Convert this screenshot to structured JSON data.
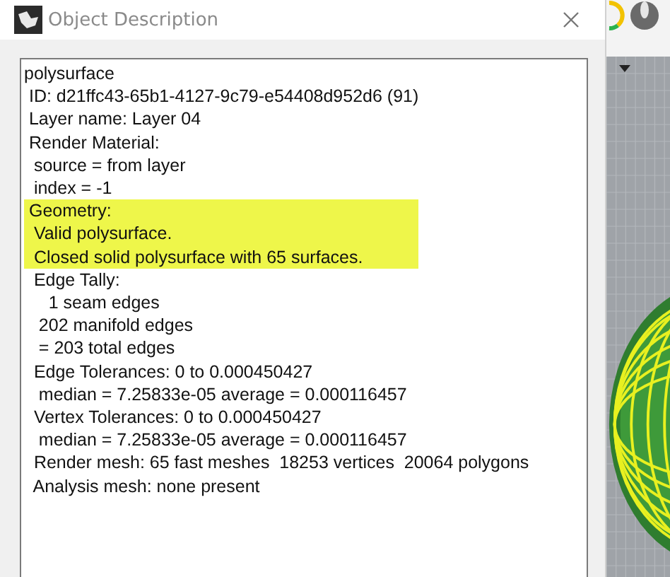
{
  "window": {
    "title": "Object Description"
  },
  "description_lines": [
    {
      "text": "polysurface",
      "highlighted": false
    },
    {
      "text": " ID: d21ffc43-65b1-4127-9c79-e54408d952d6 (91)",
      "highlighted": false
    },
    {
      "text": " Layer name: Layer 04",
      "highlighted": false
    },
    {
      "text": " Render Material:",
      "highlighted": false
    },
    {
      "text": "  source = from layer",
      "highlighted": false
    },
    {
      "text": "  index = -1",
      "highlighted": false
    },
    {
      "text": " Geometry:",
      "highlighted": true
    },
    {
      "text": "  Valid polysurface.",
      "highlighted": true
    },
    {
      "text": "  Closed solid polysurface with 65 surfaces.",
      "highlighted": true
    },
    {
      "text": "  Edge Tally:",
      "highlighted": false
    },
    {
      "text": "     1 seam edges",
      "highlighted": false
    },
    {
      "text": "   202 manifold edges",
      "highlighted": false
    },
    {
      "text": "   = 203 total edges",
      "highlighted": false
    },
    {
      "text": "  Edge Tolerances: 0 to 0.000450427",
      "highlighted": false
    },
    {
      "text": "   median = 7.25833e-05 average = 0.000116457",
      "highlighted": false
    },
    {
      "text": "  Vertex Tolerances: 0 to 0.000450427",
      "highlighted": false
    },
    {
      "text": "   median = 7.25833e-05 average = 0.000116457",
      "highlighted": false
    },
    {
      "text": "  Render mesh: 65 fast meshes  18253 vertices  20064 polygons",
      "highlighted": false
    },
    {
      "text": "  Analysis mesh: none present",
      "highlighted": false
    }
  ]
}
